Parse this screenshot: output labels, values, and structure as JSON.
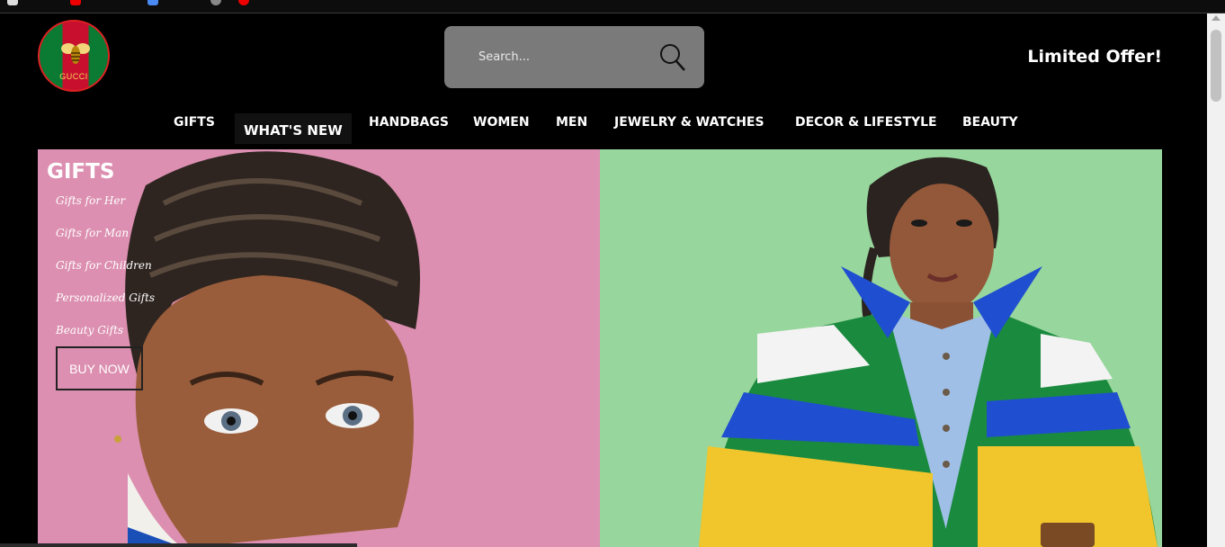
{
  "header": {
    "logo_text": "GUCCI",
    "search_placeholder": "Search...",
    "offer": "Limited Offer!"
  },
  "nav": {
    "items": [
      "GIFTS",
      "WHAT'S NEW",
      "HANDBAGS",
      "WOMEN",
      "MEN",
      "JEWELRY & WATCHES",
      "DECOR & LIFESTYLE",
      "BEAUTY"
    ],
    "active": "WHAT'S NEW"
  },
  "hero": {
    "gifts_title": "GIFTS",
    "gift_links": [
      "Gifts for Her",
      "Gifts for Man",
      "Gifts for Children",
      "Personalized Gifts",
      "Beauty Gifts"
    ],
    "buy_now": "BUY NOW"
  },
  "colors": {
    "left_panel": "#dc8fb0",
    "right_panel": "#97d69c",
    "search_bg": "#7a7a7a",
    "logo_red": "#c8102e",
    "logo_green": "#0b7a32"
  },
  "icons": [
    "search-icon",
    "bee-icon"
  ]
}
